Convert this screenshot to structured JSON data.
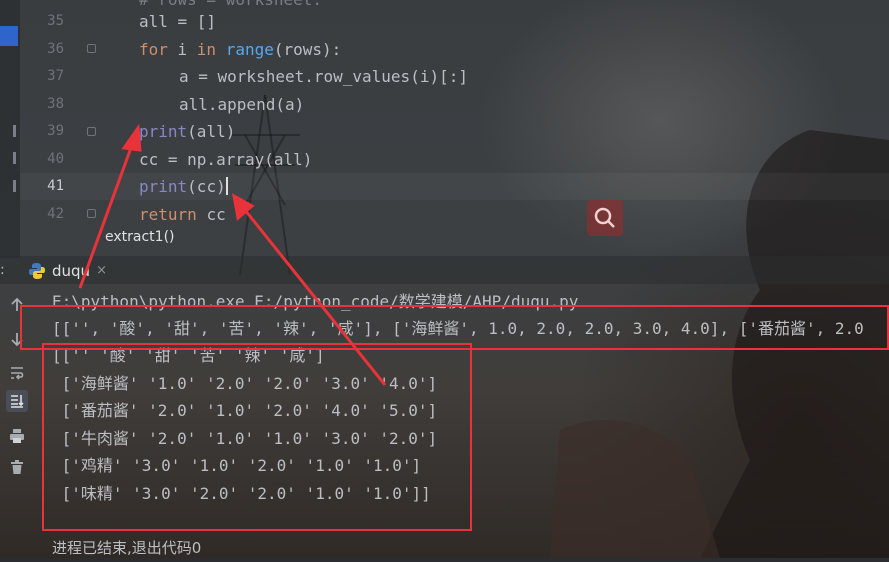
{
  "editor": {
    "line_numbers": [
      "35",
      "36",
      "37",
      "38",
      "39",
      "40",
      "41",
      "42"
    ],
    "active_line": "41",
    "lines": [
      {
        "parts": [
          [
            "plain",
            "# rows = worksheet."
          ]
        ]
      },
      {
        "parts": [
          [
            "plain",
            "all = []"
          ]
        ]
      },
      {
        "parts": [
          [
            "kw",
            "for "
          ],
          [
            "plain",
            "i "
          ],
          [
            "kw",
            "in "
          ],
          [
            "bi",
            "range"
          ],
          [
            "plain",
            "(rows):"
          ]
        ]
      },
      {
        "parts": [
          [
            "plain",
            "a = worksheet.row_values(i)[:]"
          ]
        ]
      },
      {
        "parts": [
          [
            "plain",
            "all.append(a)"
          ]
        ]
      },
      {
        "parts": [
          [
            "bi",
            "print"
          ],
          [
            "plain",
            "(all)"
          ]
        ]
      },
      {
        "parts": [
          [
            "plain",
            "cc = np.array(all)"
          ]
        ]
      },
      {
        "parts": [
          [
            "bi",
            "print"
          ],
          [
            "plain",
            "(cc)"
          ]
        ]
      },
      {
        "parts": [
          [
            "kw",
            "return "
          ],
          [
            "plain",
            "cc"
          ]
        ]
      }
    ],
    "breadcrumb": "extract1()"
  },
  "run": {
    "colon": ":",
    "tab_label": "duqu",
    "tab_close": "×",
    "toolbar_icons": [
      "scroll-up-icon",
      "scroll-down-icon",
      "soft-wrap-icon",
      "scroll-to-end-icon",
      "print-icon",
      "trash-icon"
    ],
    "output_lines": [
      "E:\\python\\python.exe E:/python_code/数学建模/AHP/duqu.py",
      "[['', '酸', '甜', '苦', '辣', '咸'], ['海鲜酱', 1.0, 2.0, 2.0, 3.0, 4.0], ['番茄酱', 2.0",
      "[['' '酸' '甜' '苦' '辣' '咸']",
      " ['海鲜酱' '1.0' '2.0' '2.0' '3.0' '4.0']",
      " ['番茄酱' '2.0' '1.0' '2.0' '4.0' '5.0']",
      " ['牛肉酱' '2.0' '1.0' '1.0' '3.0' '2.0']",
      " ['鸡精' '3.0' '1.0' '2.0' '1.0' '1.0']",
      " ['味精' '3.0' '2.0' '2.0' '1.0' '1.0']]",
      "",
      "进程已结束,退出代码0"
    ]
  },
  "colors": {
    "annotation": "#e8333a",
    "keyword": "#cf8e6d",
    "builtin": "#8888c6",
    "text": "#bcbec4"
  }
}
